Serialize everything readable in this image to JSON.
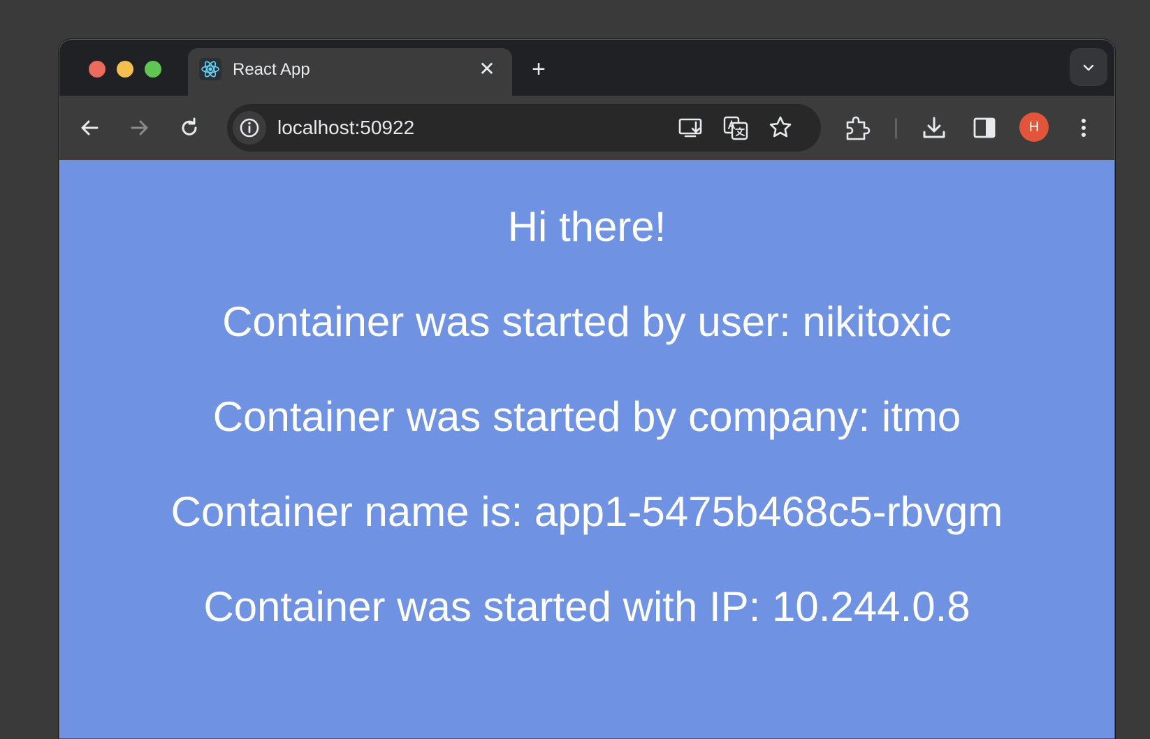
{
  "browser": {
    "tab": {
      "title": "React App",
      "favicon": "react-logo-icon",
      "close_label": "✕"
    },
    "new_tab_label": "+",
    "address_bar": {
      "url": "localhost:50922"
    },
    "profile_initial": "H",
    "colors": {
      "page_background": "#6f93e2",
      "chrome_dark": "#202124",
      "toolbar": "#3c3c3c",
      "avatar": "#e2553a"
    }
  },
  "page": {
    "greeting": "Hi there!",
    "started_by_user": "Container was started by user: nikitoxic",
    "started_by_company": "Container was started by company: itmo",
    "container_name": "Container name is: app1-5475b468c5-rbvgm",
    "container_ip": "Container was started with IP: 10.244.0.8"
  }
}
